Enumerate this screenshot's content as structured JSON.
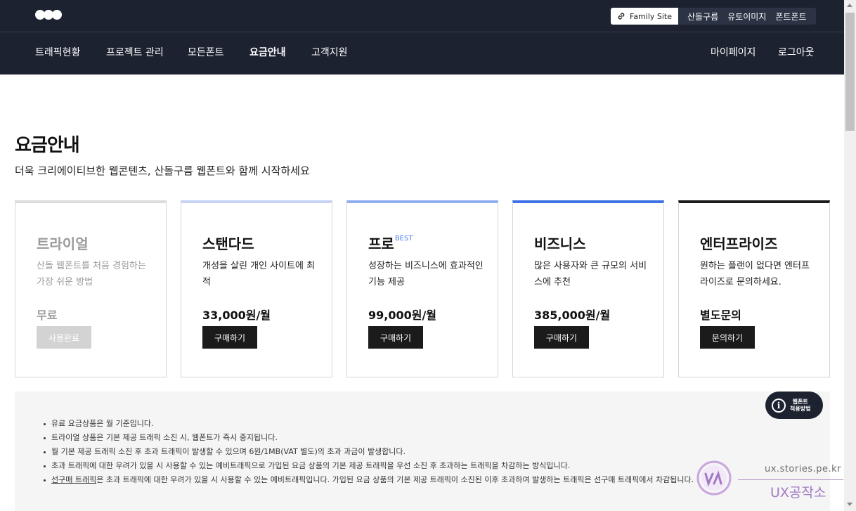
{
  "header": {
    "logo_icon": "logo-dots-icon",
    "family_site": {
      "icon": "link-icon",
      "label": "Family Site"
    },
    "family_links": [
      "산돌구름",
      "유토이미지",
      "폰트폰트"
    ]
  },
  "nav": {
    "items": [
      "트래픽현황",
      "프로젝트 관리",
      "모든폰트",
      "요금안내",
      "고객지원"
    ],
    "active": "요금안내",
    "right": [
      "마이페이지",
      "로그아웃"
    ]
  },
  "main": {
    "title": "요금안내",
    "subtitle": "더욱 크리에이티브한 웹콘텐츠, 산돌구름 웹폰트와 함께 시작하세요"
  },
  "plans": [
    {
      "name": "트라이얼",
      "badge": "",
      "desc": "산돌 웹폰트를 처음 경험하는 가장 쉬운 방법",
      "price": "무료",
      "button": "사용완료",
      "top_color": "#dddddd",
      "disabled": true
    },
    {
      "name": "스탠다드",
      "badge": "",
      "desc": "개성을 살린 개인 사이트에 최적",
      "price": "33,000원/월",
      "button": "구매하기",
      "top_color": "#c6d4f5",
      "disabled": false
    },
    {
      "name": "프로",
      "badge": "BEST",
      "desc": "성장하는 비즈니스에 효과적인 기능 제공",
      "price": "99,000원/월",
      "button": "구매하기",
      "top_color": "#8eaef0",
      "disabled": false
    },
    {
      "name": "비즈니스",
      "badge": "",
      "desc": "많은 사용자와 큰 규모의 서비스에 추천",
      "price": "385,000원/월",
      "button": "구매하기",
      "top_color": "#3f72e6",
      "disabled": false
    },
    {
      "name": "엔터프라이즈",
      "badge": "",
      "desc": "원하는 플랜이 없다면 엔터프라이즈로 문의하세요.",
      "price": "별도문의",
      "button": "문의하기",
      "top_color": "#1b1b1b",
      "disabled": false
    }
  ],
  "notice": {
    "items": [
      "유료 요금상품은 월 기준입니다.",
      "트라이얼 상품은 기본 제공 트래픽 소진 시, 웹폰트가 즉시 중지됩니다.",
      "월 기본 제공 트래픽 소진 후 초과 트래픽이 발생할 수 있으며 6원/1MB(VAT 별도)의 초과 과금이 발생합니다.",
      "초과 트래픽에 대한 우려가 있을 시 사용할 수 있는 예비트래픽으로 가입된 요금 상품의 기본 제공 트래픽을 우선 소진 후 초과하는 트래픽을 차감하는 방식입니다."
    ],
    "last_link": "선구매 트래픽",
    "last_rest": "은 초과 트래픽에 대한 우려가 있을 시 사용할 수 있는 예비트래픽입니다. 가입된 요금 상품의 기본 제공 트래픽이 소진된 이후 초과하여 발생하는 트래픽은 선구매 트래픽에서 차감됩니다."
  },
  "help_button": {
    "icon": "info-icon",
    "line1": "웹폰트",
    "line2": "적용방법"
  },
  "watermark": {
    "url": "ux.stories.pe.kr",
    "name": "UX공작소"
  },
  "colors": {
    "header_bg": "#1c2230",
    "accent": "#3f72e6",
    "button_bg": "#1b1b1b"
  }
}
